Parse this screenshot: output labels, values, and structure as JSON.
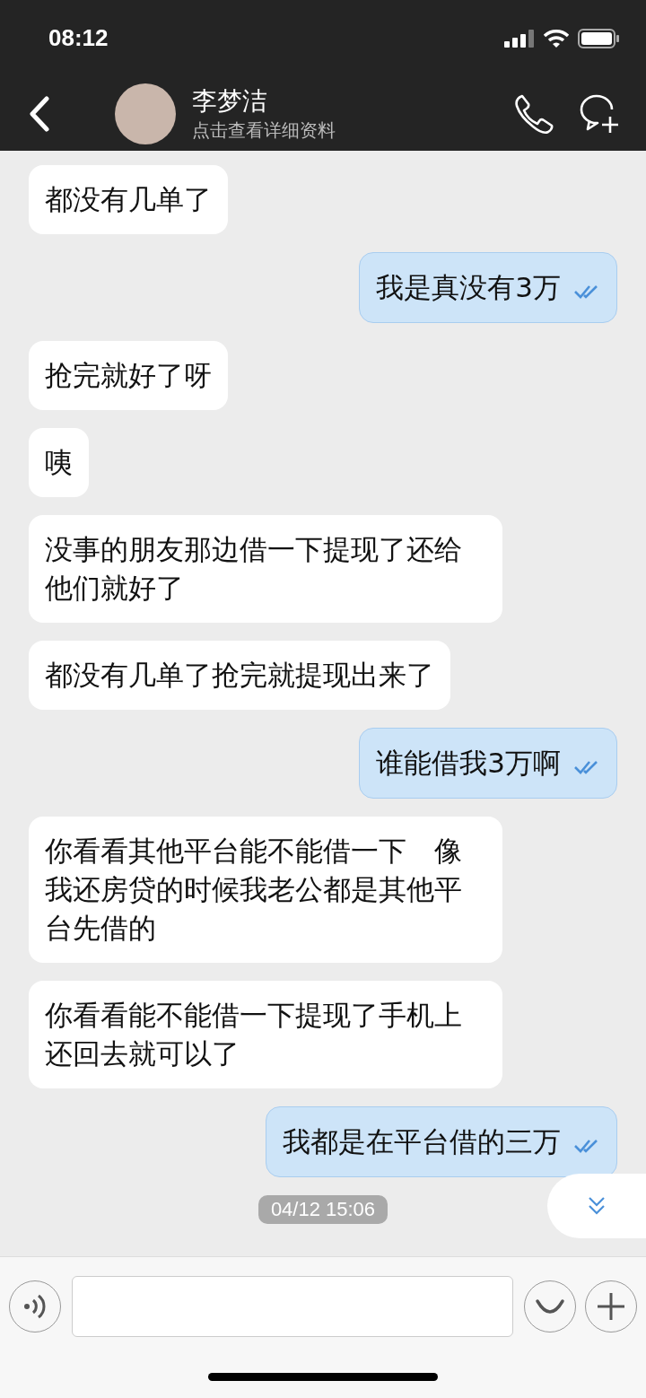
{
  "status_bar": {
    "time": "08:12"
  },
  "header": {
    "name": "李梦洁",
    "subtitle": "点击查看详细资料"
  },
  "messages": [
    {
      "kind": "received",
      "text": "都没有几单了"
    },
    {
      "kind": "sent",
      "text": "我是真没有3万",
      "read": true
    },
    {
      "kind": "received",
      "text": "抢完就好了呀"
    },
    {
      "kind": "received",
      "text": "咦"
    },
    {
      "kind": "received",
      "text": "没事的朋友那边借一下提现了还给他们就好了"
    },
    {
      "kind": "received",
      "text": "都没有几单了抢完就提现出来了"
    },
    {
      "kind": "sent",
      "text": "谁能借我3万啊",
      "read": true
    },
    {
      "kind": "received",
      "text": "你看看其他平台能不能借一下　像我还房贷的时候我老公都是其他平台先借的"
    },
    {
      "kind": "received",
      "text": "你看看能不能借一下提现了手机上还回去就可以了"
    },
    {
      "kind": "sent",
      "text": "我都是在平台借的三万",
      "read": true
    }
  ],
  "timestamp": "04/12 15:06"
}
